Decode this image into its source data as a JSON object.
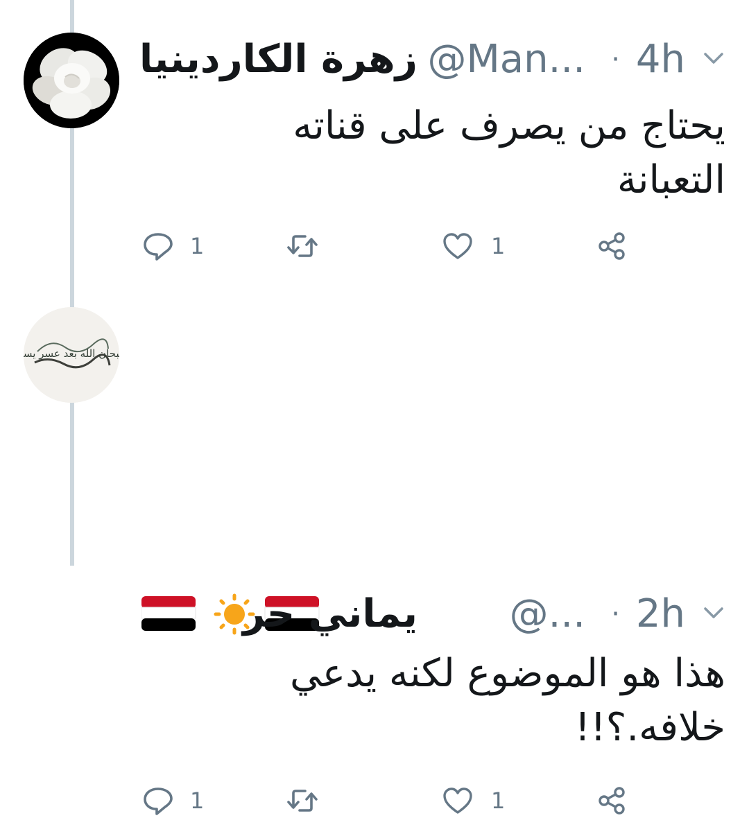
{
  "tweets": [
    {
      "display_name": "زهرة الكاردينيا",
      "handle": "@Man...",
      "separator": "·",
      "time": "4h",
      "text": "يحتاج من يصرف على قناته\nالتعبانة",
      "avatar_icon": "white-gardenia-flower",
      "reply_count": "1",
      "like_count": "1"
    },
    {
      "display_name": "يماني حر",
      "name_decorations": [
        "yemen-flag",
        "sun-emoji",
        "yemen-flag"
      ],
      "handle": "@...",
      "separator": "·",
      "time": "2h",
      "text": "هذا هو الموضوع لكنه يدعي\nخلافه.؟!!",
      "avatar_icon": "arabic-calligraphy",
      "avatar_text": "سبحان الله بعد عسر يسرا",
      "reply_count": "1",
      "like_count": "1"
    }
  ],
  "colors": {
    "text_primary": "#14171a",
    "text_secondary": "#657786",
    "thread_line": "#ccd6dd",
    "flag_red": "#ce1126",
    "flag_black": "#000000",
    "sun": "#f7a51a"
  }
}
